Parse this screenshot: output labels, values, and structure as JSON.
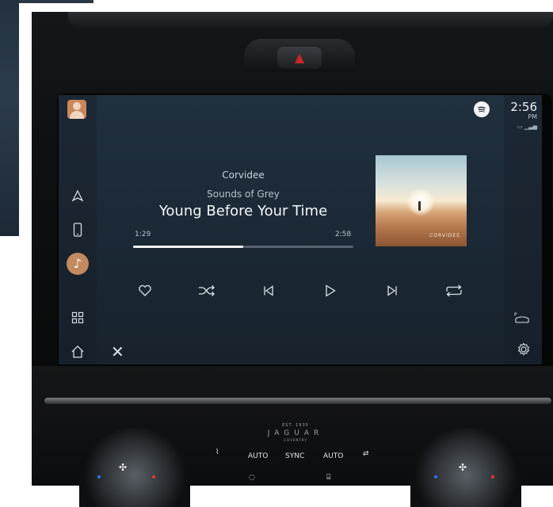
{
  "screen": {
    "track": {
      "artist": "Corvidee",
      "album": "Sounds of Grey",
      "title": "Young Before Your Time"
    },
    "progress": {
      "elapsed": "1:29",
      "total": "2:58",
      "fraction": 0.5
    },
    "album_art": {
      "caption": "CORVIDEE"
    },
    "clock": {
      "time": "2:56",
      "ampm": "PM"
    },
    "left_rail": [
      {
        "icon": "avatar-icon"
      },
      {
        "icon": "navigation-icon"
      },
      {
        "icon": "phone-icon"
      },
      {
        "icon": "music-note-icon"
      },
      {
        "icon": "apps-grid-icon"
      },
      {
        "icon": "home-icon"
      }
    ],
    "controls": [
      {
        "icon": "heart-icon"
      },
      {
        "icon": "shuffle-icon"
      },
      {
        "icon": "previous-track-icon"
      },
      {
        "icon": "play-icon"
      },
      {
        "icon": "next-track-icon"
      },
      {
        "icon": "repeat-icon"
      }
    ],
    "accent_color": "#c28a5e",
    "spotify_color": "#f4f4f4"
  },
  "dashboard": {
    "brand": {
      "est": "EST. 1935",
      "name": "JAGUAR",
      "city": "COVENTRY"
    },
    "climate": {
      "auto_left": "AUTO",
      "sync": "SYNC",
      "auto_right": "AUTO"
    },
    "hazard_color": "#c62828"
  }
}
